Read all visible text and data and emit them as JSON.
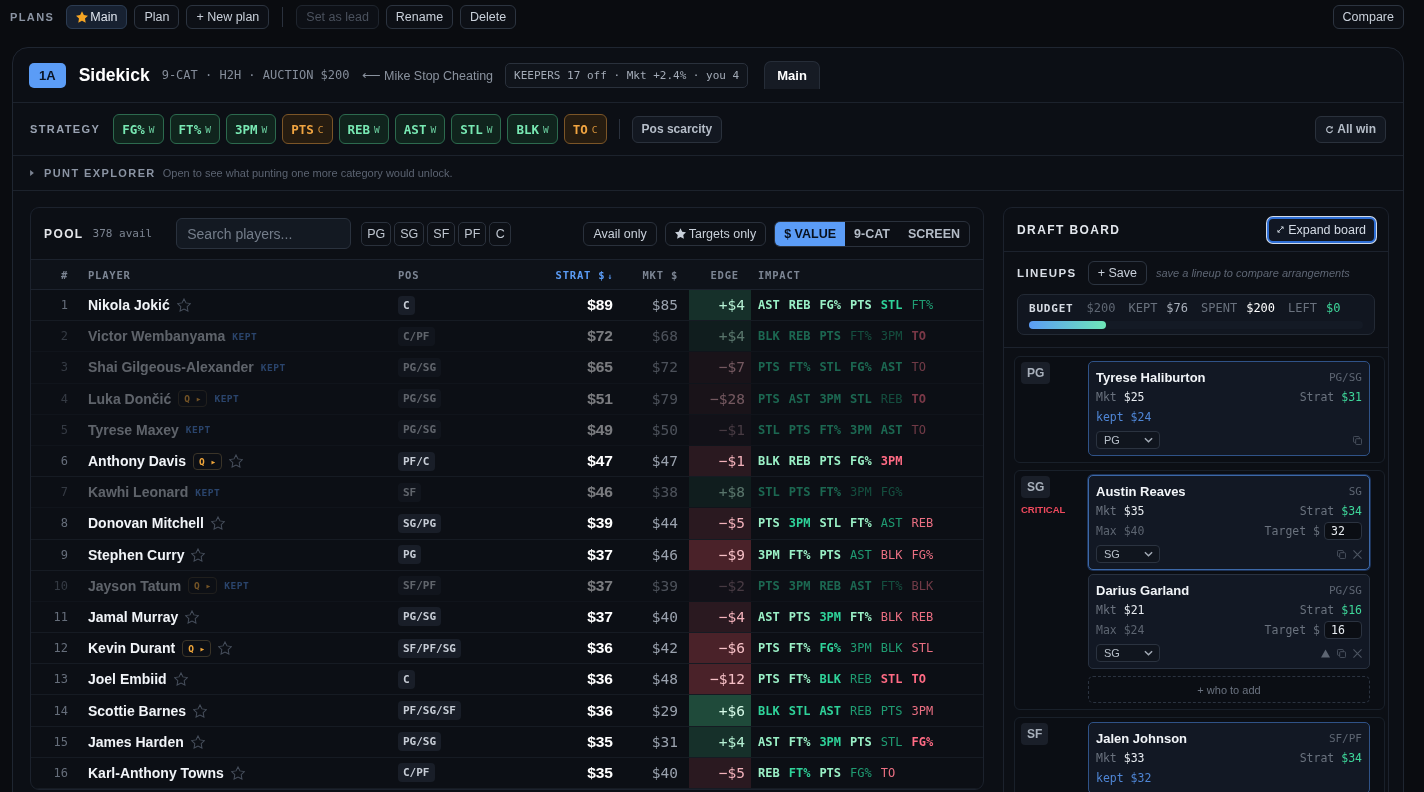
{
  "plans_bar": {
    "title": "PLANS",
    "plans": [
      {
        "label": "Main",
        "selected": true,
        "lead": true
      },
      {
        "label": "Plan",
        "selected": false,
        "lead": false
      }
    ],
    "new_plan": "+ New plan",
    "actions": [
      {
        "label": "Set as lead",
        "disabled": true
      },
      {
        "label": "Rename",
        "disabled": false
      },
      {
        "label": "Delete",
        "disabled": false
      }
    ],
    "compare": "Compare"
  },
  "league": {
    "badge": "1A",
    "name": "Sidekick",
    "format": "9-CAT · H2H · AUCTION $200",
    "opponent": "⟵ Mike Stop Cheating",
    "keepers": "KEEPERS 17 off · Mkt +2.4% · you 4",
    "tabs": [
      {
        "label": "Main",
        "selected": true
      }
    ]
  },
  "strategy": {
    "title": "STRATEGY",
    "categories": [
      {
        "label": "FG%",
        "flag": "W",
        "kind": "win"
      },
      {
        "label": "FT%",
        "flag": "W",
        "kind": "win"
      },
      {
        "label": "3PM",
        "flag": "W",
        "kind": "win"
      },
      {
        "label": "PTS",
        "flag": "C",
        "kind": "concede"
      },
      {
        "label": "REB",
        "flag": "W",
        "kind": "win"
      },
      {
        "label": "AST",
        "flag": "W",
        "kind": "win"
      },
      {
        "label": "STL",
        "flag": "W",
        "kind": "win"
      },
      {
        "label": "BLK",
        "flag": "W",
        "kind": "win"
      },
      {
        "label": "TO",
        "flag": "C",
        "kind": "concede"
      }
    ],
    "pos_scarcity": {
      "label": "Pos scarcity",
      "on": false
    },
    "reset": "All win"
  },
  "punt_explorer": {
    "title": "PUNT EXPLORER",
    "hint": "Open to see what punting one more category would unlock.",
    "expanded": false
  },
  "pool": {
    "title": "POOL",
    "count": "378 avail",
    "search": {
      "placeholder": "Search players..."
    },
    "positions": [
      {
        "label": "PG",
        "selected": false
      },
      {
        "label": "SG",
        "selected": false
      },
      {
        "label": "SF",
        "selected": false
      },
      {
        "label": "PF",
        "selected": false
      },
      {
        "label": "C",
        "selected": false
      }
    ],
    "toggles": [
      {
        "label": "Avail only",
        "on": false,
        "kind": "plain"
      },
      {
        "label": "Targets only",
        "on": false,
        "kind": "star"
      }
    ],
    "views": [
      {
        "label": "$ VALUE",
        "selected": true
      },
      {
        "label": "9-CAT",
        "selected": false
      },
      {
        "label": "SCREEN",
        "selected": false
      }
    ],
    "columns": [
      {
        "label": "#",
        "sorted": false
      },
      {
        "label": "PLAYER",
        "sorted": false
      },
      {
        "label": "POS",
        "sorted": false
      },
      {
        "label": "STRAT $",
        "sorted": true,
        "sort_mark": "↓"
      },
      {
        "label": "MKT $",
        "sorted": false
      },
      {
        "label": "EDGE",
        "sorted": false
      },
      {
        "label": "IMPACT",
        "sorted": false
      }
    ],
    "rows": [
      {
        "rank": "1",
        "name": "Nikola Jokić",
        "kept": false,
        "target": false,
        "pos": "C",
        "strat": "$89",
        "mkt": "$85",
        "edge": {
          "value": "+$4",
          "kind": "up"
        },
        "impact": [
          {
            "label": "AST",
            "kind": "big_plus"
          },
          {
            "label": "REB",
            "kind": "big_plus"
          },
          {
            "label": "FG%",
            "kind": "big_plus"
          },
          {
            "label": "PTS",
            "kind": "big_plus"
          },
          {
            "label": "STL",
            "kind": "plus"
          },
          {
            "label": "FT%",
            "kind": "small_plus"
          }
        ]
      },
      {
        "rank": "2",
        "name": "Victor Wembanyama",
        "kept": true,
        "tag": "KEPT",
        "pos": "C/PF",
        "strat": "$72",
        "mkt": "$68",
        "edge": {
          "value": "+$4",
          "kind": "up"
        },
        "impact": [
          {
            "label": "BLK",
            "kind": "plus"
          },
          {
            "label": "REB",
            "kind": "plus"
          },
          {
            "label": "PTS",
            "kind": "plus"
          },
          {
            "label": "FT%",
            "kind": "small_plus"
          },
          {
            "label": "3PM",
            "kind": "small_plus"
          },
          {
            "label": "TO",
            "kind": "minus"
          }
        ]
      },
      {
        "rank": "3",
        "name": "Shai Gilgeous-Alexander",
        "kept": true,
        "tag": "KEPT",
        "pos": "PG/SG",
        "strat": "$65",
        "mkt": "$72",
        "edge": {
          "value": "−$7",
          "kind": "down"
        },
        "impact": [
          {
            "label": "PTS",
            "kind": "plus"
          },
          {
            "label": "FT%",
            "kind": "plus"
          },
          {
            "label": "STL",
            "kind": "plus"
          },
          {
            "label": "FG%",
            "kind": "plus"
          },
          {
            "label": "AST",
            "kind": "plus"
          },
          {
            "label": "TO",
            "kind": "small_minus"
          }
        ]
      },
      {
        "rank": "4",
        "name": "Luka Dončić",
        "queue": "Q ▸",
        "kept": true,
        "tag": "KEPT",
        "pos": "PG/SG",
        "strat": "$51",
        "mkt": "$79",
        "edge": {
          "value": "−$28",
          "kind": "down"
        },
        "impact": [
          {
            "label": "PTS",
            "kind": "plus"
          },
          {
            "label": "AST",
            "kind": "plus"
          },
          {
            "label": "3PM",
            "kind": "plus"
          },
          {
            "label": "STL",
            "kind": "plus"
          },
          {
            "label": "REB",
            "kind": "small_plus"
          },
          {
            "label": "TO",
            "kind": "minus"
          }
        ]
      },
      {
        "rank": "5",
        "name": "Tyrese Maxey",
        "kept": true,
        "tag": "KEPT",
        "pos": "PG/SG",
        "strat": "$49",
        "mkt": "$50",
        "edge": {
          "value": "−$1",
          "kind": "down_faint"
        },
        "impact": [
          {
            "label": "STL",
            "kind": "plus"
          },
          {
            "label": "PTS",
            "kind": "plus"
          },
          {
            "label": "FT%",
            "kind": "plus"
          },
          {
            "label": "3PM",
            "kind": "plus"
          },
          {
            "label": "AST",
            "kind": "plus"
          },
          {
            "label": "TO",
            "kind": "small_minus"
          }
        ]
      },
      {
        "rank": "6",
        "name": "Anthony Davis",
        "queue": "Q ▸",
        "kept": false,
        "target": false,
        "pos": "PF/C",
        "strat": "$47",
        "mkt": "$47",
        "edge": {
          "value": "−$1",
          "kind": "down"
        },
        "impact": [
          {
            "label": "BLK",
            "kind": "big_plus"
          },
          {
            "label": "REB",
            "kind": "big_plus"
          },
          {
            "label": "PTS",
            "kind": "big_plus"
          },
          {
            "label": "FG%",
            "kind": "big_plus"
          },
          {
            "label": "3PM",
            "kind": "minus"
          }
        ]
      },
      {
        "rank": "7",
        "name": "Kawhi Leonard",
        "kept": true,
        "tag": "KEPT",
        "pos": "SF",
        "strat": "$46",
        "mkt": "$38",
        "edge": {
          "value": "+$8",
          "kind": "up"
        },
        "impact": [
          {
            "label": "STL",
            "kind": "plus"
          },
          {
            "label": "PTS",
            "kind": "plus"
          },
          {
            "label": "FT%",
            "kind": "plus"
          },
          {
            "label": "3PM",
            "kind": "small_plus"
          },
          {
            "label": "FG%",
            "kind": "small_plus"
          }
        ]
      },
      {
        "rank": "8",
        "name": "Donovan Mitchell",
        "kept": false,
        "target": false,
        "pos": "SG/PG",
        "strat": "$39",
        "mkt": "$44",
        "edge": {
          "value": "−$5",
          "kind": "down"
        },
        "impact": [
          {
            "label": "PTS",
            "kind": "big_plus"
          },
          {
            "label": "3PM",
            "kind": "plus"
          },
          {
            "label": "STL",
            "kind": "big_plus"
          },
          {
            "label": "FT%",
            "kind": "big_plus"
          },
          {
            "label": "AST",
            "kind": "small_plus"
          },
          {
            "label": "REB",
            "kind": "small_minus"
          }
        ]
      },
      {
        "rank": "9",
        "name": "Stephen Curry",
        "kept": false,
        "target": false,
        "pos": "PG",
        "strat": "$37",
        "mkt": "$46",
        "edge": {
          "value": "−$9",
          "kind": "down_strong"
        },
        "impact": [
          {
            "label": "3PM",
            "kind": "big_plus"
          },
          {
            "label": "FT%",
            "kind": "big_plus"
          },
          {
            "label": "PTS",
            "kind": "big_plus"
          },
          {
            "label": "AST",
            "kind": "small_plus"
          },
          {
            "label": "BLK",
            "kind": "small_minus"
          },
          {
            "label": "FG%",
            "kind": "small_minus"
          }
        ]
      },
      {
        "rank": "10",
        "name": "Jayson Tatum",
        "queue": "Q ▸",
        "kept": true,
        "tag": "KEPT",
        "pos": "SF/PF",
        "strat": "$37",
        "mkt": "$39",
        "edge": {
          "value": "−$2",
          "kind": "down_faint"
        },
        "impact": [
          {
            "label": "PTS",
            "kind": "plus"
          },
          {
            "label": "3PM",
            "kind": "plus"
          },
          {
            "label": "REB",
            "kind": "plus"
          },
          {
            "label": "AST",
            "kind": "plus"
          },
          {
            "label": "FT%",
            "kind": "small_plus"
          },
          {
            "label": "BLK",
            "kind": "small_minus"
          }
        ]
      },
      {
        "rank": "11",
        "name": "Jamal Murray",
        "kept": false,
        "target": false,
        "pos": "PG/SG",
        "strat": "$37",
        "mkt": "$40",
        "edge": {
          "value": "−$4",
          "kind": "down"
        },
        "impact": [
          {
            "label": "AST",
            "kind": "big_plus"
          },
          {
            "label": "PTS",
            "kind": "big_plus"
          },
          {
            "label": "3PM",
            "kind": "plus"
          },
          {
            "label": "FT%",
            "kind": "big_plus"
          },
          {
            "label": "BLK",
            "kind": "small_minus"
          },
          {
            "label": "REB",
            "kind": "small_minus"
          }
        ]
      },
      {
        "rank": "12",
        "name": "Kevin Durant",
        "queue": "Q ▸",
        "kept": false,
        "target": false,
        "pos": "SF/PF/SG",
        "strat": "$36",
        "mkt": "$42",
        "edge": {
          "value": "−$6",
          "kind": "down_strong"
        },
        "impact": [
          {
            "label": "PTS",
            "kind": "big_plus"
          },
          {
            "label": "FT%",
            "kind": "big_plus"
          },
          {
            "label": "FG%",
            "kind": "plus"
          },
          {
            "label": "3PM",
            "kind": "small_plus"
          },
          {
            "label": "BLK",
            "kind": "small_plus"
          },
          {
            "label": "STL",
            "kind": "small_minus"
          }
        ]
      },
      {
        "rank": "13",
        "name": "Joel Embiid",
        "kept": false,
        "target": false,
        "pos": "C",
        "strat": "$36",
        "mkt": "$48",
        "edge": {
          "value": "−$12",
          "kind": "down_strong"
        },
        "impact": [
          {
            "label": "PTS",
            "kind": "big_plus"
          },
          {
            "label": "FT%",
            "kind": "big_plus"
          },
          {
            "label": "BLK",
            "kind": "plus"
          },
          {
            "label": "REB",
            "kind": "small_plus"
          },
          {
            "label": "STL",
            "kind": "minus"
          },
          {
            "label": "TO",
            "kind": "minus"
          }
        ]
      },
      {
        "rank": "14",
        "name": "Scottie Barnes",
        "kept": false,
        "target": false,
        "pos": "PF/SG/SF",
        "strat": "$36",
        "mkt": "$29",
        "edge": {
          "value": "+$6",
          "kind": "up_strong"
        },
        "impact": [
          {
            "label": "BLK",
            "kind": "plus"
          },
          {
            "label": "STL",
            "kind": "plus"
          },
          {
            "label": "AST",
            "kind": "plus"
          },
          {
            "label": "REB",
            "kind": "small_plus"
          },
          {
            "label": "PTS",
            "kind": "small_plus"
          },
          {
            "label": "3PM",
            "kind": "small_minus"
          }
        ]
      },
      {
        "rank": "15",
        "name": "James Harden",
        "kept": false,
        "target": false,
        "pos": "PG/SG",
        "strat": "$35",
        "mkt": "$31",
        "edge": {
          "value": "+$4",
          "kind": "up"
        },
        "impact": [
          {
            "label": "AST",
            "kind": "big_plus"
          },
          {
            "label": "FT%",
            "kind": "big_plus"
          },
          {
            "label": "3PM",
            "kind": "plus"
          },
          {
            "label": "PTS",
            "kind": "big_plus"
          },
          {
            "label": "STL",
            "kind": "small_plus"
          },
          {
            "label": "FG%",
            "kind": "minus"
          }
        ]
      },
      {
        "rank": "16",
        "name": "Karl-Anthony Towns",
        "kept": false,
        "target": false,
        "pos": "C/PF",
        "strat": "$35",
        "mkt": "$40",
        "edge": {
          "value": "−$5",
          "kind": "down"
        },
        "impact": [
          {
            "label": "REB",
            "kind": "big_plus"
          },
          {
            "label": "FT%",
            "kind": "plus"
          },
          {
            "label": "PTS",
            "kind": "big_plus"
          },
          {
            "label": "FG%",
            "kind": "small_plus"
          },
          {
            "label": "TO",
            "kind": "small_minus"
          }
        ]
      }
    ]
  },
  "draft_board": {
    "title": "DRAFT BOARD",
    "expand": "Expand board",
    "lineups": {
      "title": "LINEUPS",
      "save": "+ Save",
      "hint": "save a lineup to compare arrangements"
    },
    "budget": {
      "title": "BUDGET",
      "total": "$200",
      "stats": [
        {
          "label": "KEPT",
          "value": "$76",
          "kind": "plain"
        },
        {
          "label": "SPENT",
          "value": "$200",
          "kind": "strong"
        },
        {
          "label": "LEFT",
          "value": "$0",
          "kind": "good"
        }
      ],
      "level": 0.23
    },
    "slots": [
      {
        "pos": "PG",
        "players": [
          {
            "name": "Tyrese Haliburton",
            "pos": "PG/SG",
            "selected": false,
            "mkt_label": "Mkt",
            "mkt": "$25",
            "strat_label": "Strat",
            "strat": "$31",
            "kept": "kept $24",
            "slot": "PG",
            "actions": [
              {
                "kind": "copy"
              }
            ]
          }
        ]
      },
      {
        "pos": "SG",
        "status": "CRITICAL",
        "players": [
          {
            "name": "Austin Reaves",
            "pos": "SG",
            "selected": true,
            "mkt_label": "Mkt",
            "mkt": "$35",
            "strat_label": "Strat",
            "strat": "$34",
            "max_label": "Max",
            "max": "$40",
            "target_label": "Target $",
            "target": "32",
            "slot": "SG",
            "actions": [
              {
                "kind": "copy"
              },
              {
                "kind": "remove"
              }
            ]
          },
          {
            "name": "Darius Garland",
            "pos": "PG/SG",
            "selected": false,
            "mkt_label": "Mkt",
            "mkt": "$21",
            "strat_label": "Strat",
            "strat": "$16",
            "max_label": "Max",
            "max": "$24",
            "target_label": "Target $",
            "target": "16",
            "slot": "SG",
            "actions": [
              {
                "kind": "move_up"
              },
              {
                "kind": "copy"
              },
              {
                "kind": "remove"
              }
            ]
          }
        ],
        "add_label": "+ who to add"
      },
      {
        "pos": "SF",
        "players": [
          {
            "name": "Jalen Johnson",
            "pos": "SF/PF",
            "selected": false,
            "mkt_label": "Mkt",
            "mkt": "$33",
            "strat_label": "Strat",
            "strat": "$34",
            "kept": "kept $32"
          }
        ]
      }
    ]
  }
}
